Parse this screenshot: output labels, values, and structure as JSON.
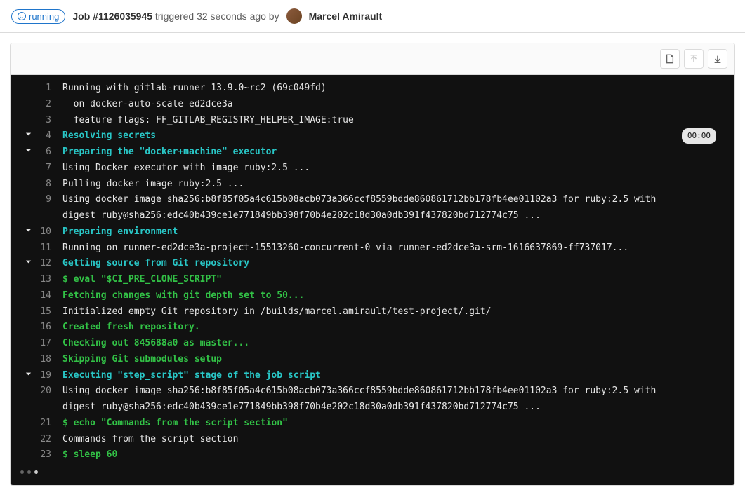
{
  "header": {
    "status": "running",
    "job_label": "Job #1126035945",
    "triggered_text": "triggered 32 seconds ago by",
    "author": "Marcel Amirault"
  },
  "toolbar": {
    "raw": "Show complete raw",
    "scroll_top": "Scroll to top",
    "scroll_bottom": "Scroll to bottom"
  },
  "duration": "00:00",
  "lines": [
    {
      "n": 1,
      "fold": false,
      "cls": "",
      "t": "Running with gitlab-runner 13.9.0~rc2 (69c049fd)"
    },
    {
      "n": 2,
      "fold": false,
      "cls": "",
      "t": "  on docker-auto-scale ed2dce3a"
    },
    {
      "n": 3,
      "fold": false,
      "cls": "",
      "t": "  feature flags: FF_GITLAB_REGISTRY_HELPER_IMAGE:true"
    },
    {
      "n": 4,
      "fold": true,
      "cls": "cyan",
      "t": "Resolving secrets",
      "dur": true
    },
    {
      "n": 6,
      "fold": true,
      "cls": "cyan",
      "t": "Preparing the \"docker+machine\" executor"
    },
    {
      "n": 7,
      "fold": false,
      "cls": "",
      "t": "Using Docker executor with image ruby:2.5 ..."
    },
    {
      "n": 8,
      "fold": false,
      "cls": "",
      "t": "Pulling docker image ruby:2.5 ..."
    },
    {
      "n": 9,
      "fold": false,
      "cls": "",
      "t": "Using docker image sha256:b8f85f05a4c615b08acb073a366ccf8559bdde860861712bb178fb4ee01102a3 for ruby:2.5 with digest ruby@sha256:edc40b439ce1e771849bb398f70b4e202c18d30a0db391f437820bd712774c75 ..."
    },
    {
      "n": 10,
      "fold": true,
      "cls": "cyan",
      "t": "Preparing environment"
    },
    {
      "n": 11,
      "fold": false,
      "cls": "",
      "t": "Running on runner-ed2dce3a-project-15513260-concurrent-0 via runner-ed2dce3a-srm-1616637869-ff737017..."
    },
    {
      "n": 12,
      "fold": true,
      "cls": "cyan",
      "t": "Getting source from Git repository"
    },
    {
      "n": 13,
      "fold": false,
      "cls": "green",
      "t": "$ eval \"$CI_PRE_CLONE_SCRIPT\""
    },
    {
      "n": 14,
      "fold": false,
      "cls": "green",
      "t": "Fetching changes with git depth set to 50..."
    },
    {
      "n": 15,
      "fold": false,
      "cls": "",
      "t": "Initialized empty Git repository in /builds/marcel.amirault/test-project/.git/"
    },
    {
      "n": 16,
      "fold": false,
      "cls": "green",
      "t": "Created fresh repository."
    },
    {
      "n": 17,
      "fold": false,
      "cls": "green",
      "t": "Checking out 845688a0 as master..."
    },
    {
      "n": 18,
      "fold": false,
      "cls": "green",
      "t": "Skipping Git submodules setup"
    },
    {
      "n": 19,
      "fold": true,
      "cls": "cyan",
      "t": "Executing \"step_script\" stage of the job script"
    },
    {
      "n": 20,
      "fold": false,
      "cls": "",
      "t": "Using docker image sha256:b8f85f05a4c615b08acb073a366ccf8559bdde860861712bb178fb4ee01102a3 for ruby:2.5 with digest ruby@sha256:edc40b439ce1e771849bb398f70b4e202c18d30a0db391f437820bd712774c75 ..."
    },
    {
      "n": 21,
      "fold": false,
      "cls": "green",
      "t": "$ echo \"Commands from the script section\""
    },
    {
      "n": 22,
      "fold": false,
      "cls": "",
      "t": "Commands from the script section"
    },
    {
      "n": 23,
      "fold": false,
      "cls": "green",
      "t": "$ sleep 60"
    }
  ]
}
